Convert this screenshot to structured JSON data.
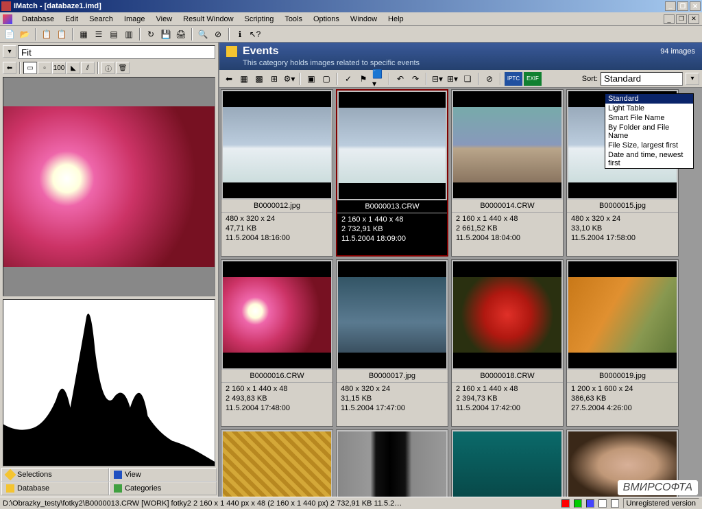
{
  "window": {
    "title": "IMatch - [databaze1.imd]"
  },
  "menu": [
    "Database",
    "Edit",
    "Search",
    "Image",
    "View",
    "Result Window",
    "Scripting",
    "Tools",
    "Options",
    "Window",
    "Help"
  ],
  "left": {
    "zoom": "Fit",
    "tabs": {
      "selections": "Selections",
      "view": "View",
      "database": "Database",
      "categories": "Categories"
    }
  },
  "category": {
    "title": "Events",
    "desc": "This category holds images related to specific events",
    "count": "94 images"
  },
  "sort": {
    "label": "Sort:",
    "value": "Standard",
    "options": [
      "Standard",
      "Light Table",
      "Smart File Name",
      "By Folder and File Name",
      "File Size, largest first",
      "Date and time, newest first"
    ]
  },
  "thumbs": [
    {
      "file": "B0000012.jpg",
      "dims": "480 x 320 x 24",
      "size": "47,71 KB",
      "date": "11.5.2004 18:16:00",
      "cls": "fake-snow",
      "sel": false
    },
    {
      "file": "B0000013.CRW",
      "dims": "2 160 x 1 440 x 48",
      "size": "2 732,91 KB",
      "date": "11.5.2004 18:09:00",
      "cls": "fake-snow",
      "sel": true
    },
    {
      "file": "B0000014.CRW",
      "dims": "2 160 x 1 440 x 48",
      "size": "2 661,52 KB",
      "date": "11.5.2004 18:04:00",
      "cls": "fake-rock",
      "sel": false
    },
    {
      "file": "B0000015.jpg",
      "dims": "480 x 320 x 24",
      "size": "33,10 KB",
      "date": "11.5.2004 17:58:00",
      "cls": "fake-snow",
      "sel": false
    },
    {
      "file": "B0000016.CRW",
      "dims": "2 160 x 1 440 x 48",
      "size": "2 493,83 KB",
      "date": "11.5.2004 17:48:00",
      "cls": "fake-flower",
      "sel": false
    },
    {
      "file": "B0000017.jpg",
      "dims": "480 x 320 x 24",
      "size": "31,15 KB",
      "date": "11.5.2004 17:47:00",
      "cls": "fake-palm",
      "sel": false
    },
    {
      "file": "B0000018.CRW",
      "dims": "2 160 x 1 440 x 48",
      "size": "2 394,73 KB",
      "date": "11.5.2004 17:42:00",
      "cls": "fake-berry",
      "sel": false
    },
    {
      "file": "B0000019.jpg",
      "dims": "1 200 x 1 600 x 24",
      "size": "386,63 KB",
      "date": "27.5.2004 4:26:00",
      "cls": "fake-poppy",
      "sel": false
    }
  ],
  "thumbs_partial": [
    {
      "cls": "fake-yellow"
    },
    {
      "cls": "fake-door"
    },
    {
      "cls": "fake-teal"
    },
    {
      "cls": "fake-face"
    }
  ],
  "status": {
    "text": "D:\\Obrazky_testy\\fotky2\\B0000013.CRW [WORK]  fotky2  2 160 x 1 440 px x 48 (2 160 x 1 440 px)   2 732,91 KB  11.5.2…",
    "reg": "Unregistered version"
  },
  "watermark": "ВМИРСОФТА"
}
